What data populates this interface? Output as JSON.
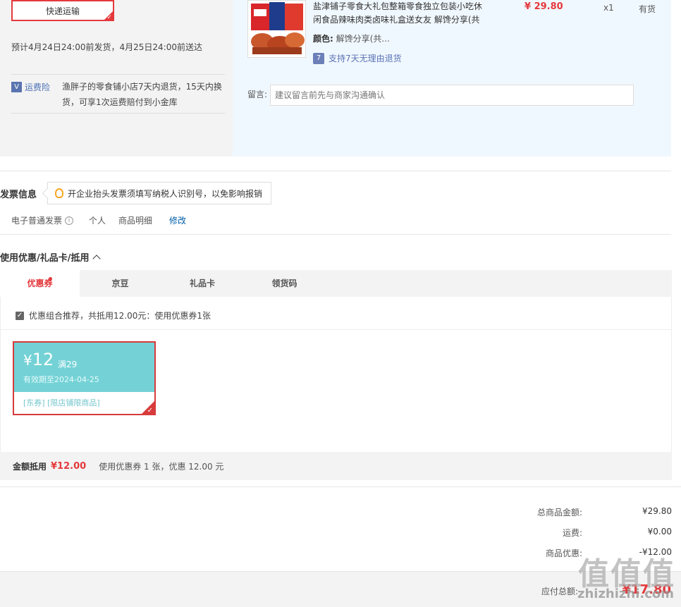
{
  "shipping": {
    "method_label": "快递运输",
    "delivery_text": "预计4月24日24:00前发货，4月25日24:00前送达",
    "insurance_badge": "运费险",
    "insurance_text": "渔胖子的零食铺小店7天内退货，15天内换货，可享1次运费赔付到小金库"
  },
  "product": {
    "title": "盐津铺子零食大礼包整箱零食独立包装小吃休闲食品辣味肉类卤味礼盒送女友 解馋分享(共",
    "color_label": "颜色:",
    "color_value": "解馋分享(共...",
    "return_icon": "7",
    "return_text": "支持7天无理由退货",
    "price": "¥ 29.80",
    "qty": "x1",
    "stock": "有货",
    "message_label": "留言:",
    "message_placeholder": "建议留言前先与商家沟通确认"
  },
  "invoice": {
    "title": "发票信息",
    "tip": "开企业抬头发票须填写纳税人识别号，以免影响报销",
    "type": "电子普通发票",
    "info_icon": "i",
    "holder": "个人",
    "content": "商品明细",
    "edit": "修改"
  },
  "coupons": {
    "title": "使用优惠/礼品卡/抵用",
    "tabs": [
      "优惠券",
      "京豆",
      "礼品卡",
      "领货码"
    ],
    "combo_text": "优惠组合推荐，共抵用12.00元：使用优惠券1张",
    "card": {
      "currency": "¥",
      "amount": "12",
      "limit": "满29",
      "valid": "有效期至2024-04-25",
      "tags": "[东券] [限店铺限商品]"
    },
    "deduct_label": "金额抵用",
    "deduct_amount": "¥12.00",
    "deduct_desc": "使用优惠券 1 张，优惠 12.00 元"
  },
  "summary": {
    "rows": [
      {
        "label": "总商品金额:",
        "value": "¥29.80"
      },
      {
        "label": "运费:",
        "value": "¥0.00"
      },
      {
        "label": "商品优惠:",
        "value": "-¥12.00"
      }
    ],
    "pay_label": "应付总额:",
    "pay_value": "¥17.80"
  },
  "watermark": {
    "logo": "值值值",
    "url": "zhizhizhi.com"
  },
  "colors": {
    "accent": "#e4393c",
    "coupon_teal": "#74d2d6",
    "link_blue": "#005ea7"
  }
}
